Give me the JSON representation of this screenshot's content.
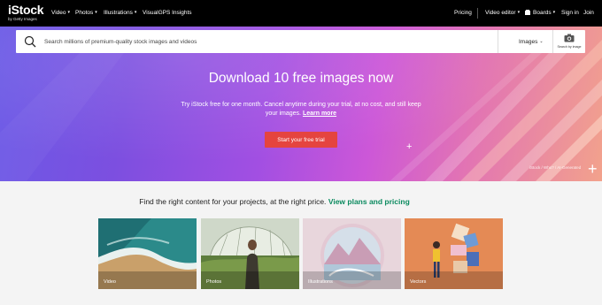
{
  "brand": {
    "name": "iStock",
    "tagline": "by Getty Images"
  },
  "nav": {
    "left": [
      {
        "label": "Video",
        "has_caret": true
      },
      {
        "label": "Photos",
        "has_caret": true
      },
      {
        "label": "Illustrations",
        "has_caret": true
      },
      {
        "label": "VisualGPS Insights",
        "has_caret": false
      }
    ],
    "pricing": "Pricing",
    "video_editor": "Video editor",
    "boards": "Boards",
    "signin": "Sign in",
    "join": "Join"
  },
  "search": {
    "placeholder": "Search millions of premium-quality stock images and videos",
    "type_selected": "Images",
    "by_image_label": "Search by image"
  },
  "hero": {
    "title": "Download 10 free images now",
    "subtitle": "Try iStock free for one month. Cancel anytime during your trial, at no cost, and still keep your images.",
    "learn_more": "Learn more",
    "cta": "Start your free trial",
    "credit": "iStock / Who? / AI-Generated"
  },
  "section": {
    "title": "Find the right content for your projects, at the right price.",
    "link": "View plans and pricing"
  },
  "cards": [
    {
      "label": "Video"
    },
    {
      "label": "Photos"
    },
    {
      "label": "Illustrations"
    },
    {
      "label": "Vectors"
    }
  ],
  "colors": {
    "nav_bg": "#000000",
    "cta": "#e5443f",
    "link_green": "#0b8a5f",
    "hero_start": "#6b5ae6",
    "hero_end": "#f2a28c"
  },
  "icons": [
    "search-icon",
    "chevron-down-icon",
    "camera-icon",
    "boards-icon",
    "plus-icon"
  ]
}
